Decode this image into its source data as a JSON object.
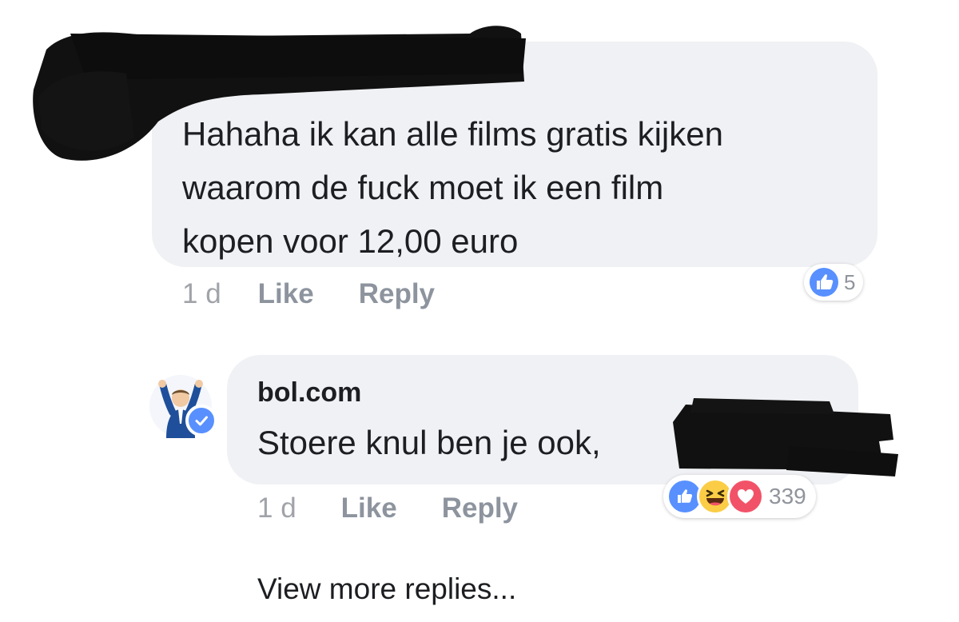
{
  "comment": {
    "text": "Hahaha ik kan alle films gratis kijken\nwaarom de fuck moet ik een film\nkopen voor 12,00 euro",
    "time": "1 d",
    "like_label": "Like",
    "reply_label": "Reply",
    "reaction_icons": [
      "like-icon"
    ],
    "reaction_count": "5"
  },
  "reply": {
    "author": "bol.com",
    "text": "Stoere knul ben je ook,",
    "time": "1 d",
    "like_label": "Like",
    "reply_label": "Reply",
    "reaction_icons": [
      "like-icon",
      "haha-icon",
      "love-icon"
    ],
    "reaction_count": "339"
  },
  "view_more_label": "View more replies...",
  "colors": {
    "bubble": "#f0f1f4",
    "like_blue": "#5890ff",
    "love_red": "#f25268",
    "haha_yellow": "#fbcd46",
    "meta_gray": "#90949c",
    "redaction": "#111111"
  }
}
